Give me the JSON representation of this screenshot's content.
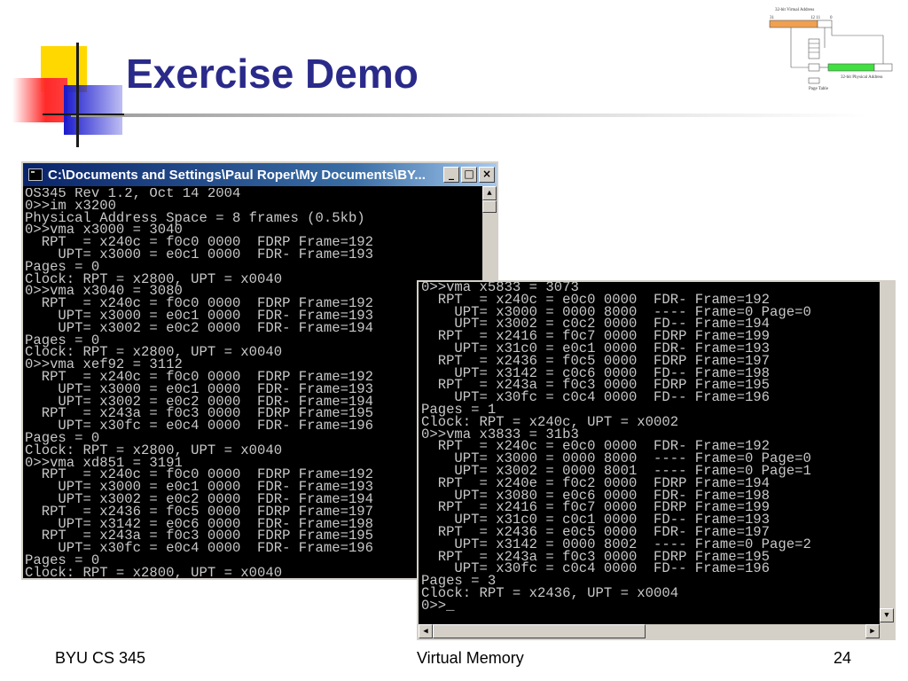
{
  "slide": {
    "title": "Exercise Demo"
  },
  "diagram": {
    "virtual_label": "32-bit Virtual Address",
    "bit_31": "31",
    "bit_mid": "12 11",
    "bit_0": "0",
    "page_table_label": "Page Table",
    "physical_label": "32-bit Physical Address"
  },
  "console_left": {
    "title": "C:\\Documents and Settings\\Paul Roper\\My Documents\\BY...",
    "minimize": "_",
    "maximize": "□",
    "close": "×",
    "lines": [
      "OS345 Rev 1.2, Oct 14 2004",
      "0>>im x3200",
      "Physical Address Space = 8 frames (0.5kb)",
      "0>>vma x3000 = 3040",
      "  RPT  = x240c = f0c0 0000  FDRP Frame=192",
      "    UPT= x3000 = e0c1 0000  FDR- Frame=193",
      "Pages = 0",
      "Clock: RPT = x2800, UPT = x0040",
      "0>>vma x3040 = 3080",
      "  RPT  = x240c = f0c0 0000  FDRP Frame=192",
      "    UPT= x3000 = e0c1 0000  FDR- Frame=193",
      "    UPT= x3002 = e0c2 0000  FDR- Frame=194",
      "Pages = 0",
      "Clock: RPT = x2800, UPT = x0040",
      "0>>vma xef92 = 3112",
      "  RPT  = x240c = f0c0 0000  FDRP Frame=192",
      "    UPT= x3000 = e0c1 0000  FDR- Frame=193",
      "    UPT= x3002 = e0c2 0000  FDR- Frame=194",
      "  RPT  = x243a = f0c3 0000  FDRP Frame=195",
      "    UPT= x30fc = e0c4 0000  FDR- Frame=196",
      "Pages = 0",
      "Clock: RPT = x2800, UPT = x0040",
      "0>>vma xd851 = 3191",
      "  RPT  = x240c = f0c0 0000  FDRP Frame=192",
      "    UPT= x3000 = e0c1 0000  FDR- Frame=193",
      "    UPT= x3002 = e0c2 0000  FDR- Frame=194",
      "  RPT  = x2436 = f0c5 0000  FDRP Frame=197",
      "    UPT= x3142 = e0c6 0000  FDR- Frame=198",
      "  RPT  = x243a = f0c3 0000  FDRP Frame=195",
      "    UPT= x30fc = e0c4 0000  FDR- Frame=196",
      "Pages = 0",
      "Clock: RPT = x2800, UPT = x0040"
    ]
  },
  "console_right": {
    "lines": [
      "0>>vma x5833 = 3073",
      "  RPT  = x240c = e0c0 0000  FDR- Frame=192",
      "    UPT= x3000 = 0000 8000  ---- Frame=0 Page=0",
      "    UPT= x3002 = c0c2 0000  FD-- Frame=194",
      "  RPT  = x2416 = f0c7 0000  FDRP Frame=199",
      "    UPT= x31c0 = e0c1 0000  FDR- Frame=193",
      "  RPT  = x2436 = f0c5 0000  FDRP Frame=197",
      "    UPT= x3142 = c0c6 0000  FD-- Frame=198",
      "  RPT  = x243a = f0c3 0000  FDRP Frame=195",
      "    UPT= x30fc = c0c4 0000  FD-- Frame=196",
      "Pages = 1",
      "Clock: RPT = x240c, UPT = x0002",
      "0>>vma x3833 = 31b3",
      "  RPT  = x240c = e0c0 0000  FDR- Frame=192",
      "    UPT= x3000 = 0000 8000  ---- Frame=0 Page=0",
      "    UPT= x3002 = 0000 8001  ---- Frame=0 Page=1",
      "  RPT  = x240e = f0c2 0000  FDRP Frame=194",
      "    UPT= x3080 = e0c6 0000  FDR- Frame=198",
      "  RPT  = x2416 = f0c7 0000  FDRP Frame=199",
      "    UPT= x31c0 = c0c1 0000  FD-- Frame=193",
      "  RPT  = x2436 = e0c5 0000  FDR- Frame=197",
      "    UPT= x3142 = 0000 8002  ---- Frame=0 Page=2",
      "  RPT  = x243a = f0c3 0000  FDRP Frame=195",
      "    UPT= x30fc = c0c4 0000  FD-- Frame=196",
      "Pages = 3",
      "Clock: RPT = x2436, UPT = x0004",
      "0>>_"
    ]
  },
  "footer": {
    "left": "BYU CS 345",
    "center": "Virtual Memory",
    "page_number": "24"
  }
}
